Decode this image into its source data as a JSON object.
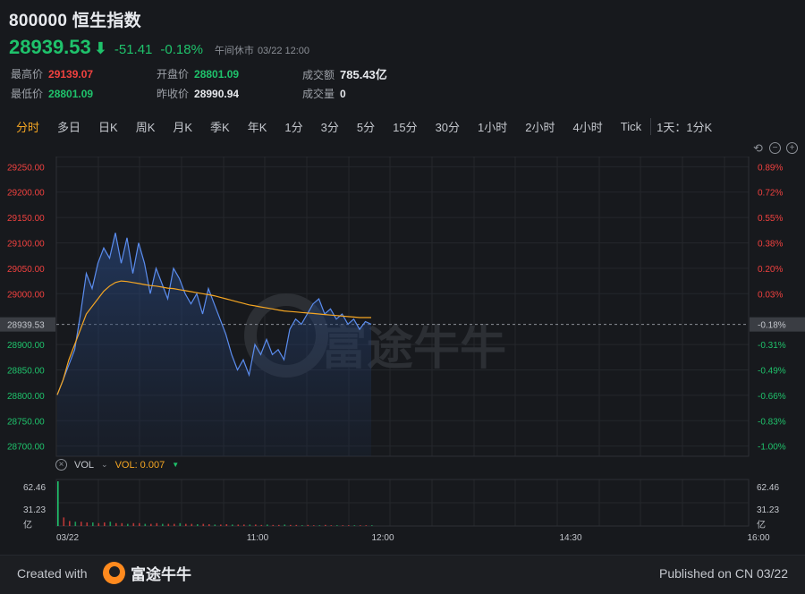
{
  "header": {
    "title": "800000 恒生指数",
    "price": "28939.53",
    "arrow": "⬇",
    "change": "-51.41",
    "change_pct": "-0.18%",
    "status": "午间休市",
    "datetime": "03/22 12:00"
  },
  "stats": {
    "high_label": "最高价",
    "high": "29139.07",
    "low_label": "最低价",
    "low": "28801.09",
    "open_label": "开盘价",
    "open": "28801.09",
    "prev_label": "昨收价",
    "prev": "28990.94",
    "turnover_label": "成交额",
    "turnover": "785.43亿",
    "volume_label": "成交量",
    "volume": "0"
  },
  "tabs": [
    "分时",
    "多日",
    "日K",
    "周K",
    "月K",
    "季K",
    "年K",
    "1分",
    "3分",
    "5分",
    "15分",
    "30分",
    "1小时",
    "2小时",
    "4小时",
    "Tick"
  ],
  "active_tab": "分时",
  "duration": "1天：1分K",
  "tools": {
    "reset": "⟲",
    "zoom_out": "−",
    "zoom_in": "+"
  },
  "volume_panel": {
    "name": "VOL",
    "dropdown": "⌄",
    "value": "VOL: 0.007",
    "trend": "▼",
    "axis_labels": [
      "62.46",
      "31.23",
      "亿"
    ]
  },
  "watermark": "富途牛牛",
  "footer": {
    "created": "Created with",
    "brand": "富途牛牛",
    "published": "Published on CN 03/22"
  },
  "colors": {
    "up": "#f0413f",
    "down": "#1fc26b",
    "accent": "#f5a623",
    "line": "#5b8def",
    "avg": "#f5a623"
  },
  "chart_data": {
    "type": "line",
    "y_left_ticks": [
      "29250.00",
      "29200.00",
      "29150.00",
      "29100.00",
      "29050.00",
      "29000.00",
      "28939.53",
      "28900.00",
      "28850.00",
      "28800.00",
      "28750.00",
      "28700.00"
    ],
    "y_right_ticks": [
      "0.89%",
      "0.72%",
      "0.55%",
      "0.38%",
      "0.20%",
      "0.03%",
      "-0.18%",
      "-0.31%",
      "-0.49%",
      "-0.66%",
      "-0.83%",
      "-1.00%"
    ],
    "x_ticks": [
      "03/22",
      "11:00",
      "12:00",
      "14:30",
      "16:00"
    ],
    "ylim": [
      28680,
      29270
    ],
    "last_price": 28939.53,
    "price": [
      28801,
      28830,
      28860,
      28890,
      28960,
      29040,
      29010,
      29060,
      29090,
      29070,
      29120,
      29060,
      29110,
      29040,
      29100,
      29060,
      29000,
      29050,
      29020,
      28990,
      29050,
      29030,
      29000,
      28980,
      29000,
      28960,
      29010,
      28980,
      28950,
      28920,
      28880,
      28850,
      28870,
      28840,
      28900,
      28880,
      28910,
      28880,
      28890,
      28870,
      28930,
      28950,
      28940,
      28960,
      28980,
      28990,
      28960,
      28970,
      28950,
      28960,
      28940,
      28950,
      28930,
      28945,
      28940
    ],
    "avg": [
      28801,
      28830,
      28870,
      28900,
      28930,
      28960,
      28975,
      28990,
      29005,
      29015,
      29022,
      29025,
      29024,
      29022,
      29020,
      29018,
      29016,
      29015,
      29013,
      29011,
      29010,
      29008,
      29006,
      29004,
      29002,
      29000,
      28998,
      28996,
      28993,
      28990,
      28987,
      28984,
      28981,
      28978,
      28976,
      28974,
      28972,
      28970,
      28968,
      28966,
      28965,
      28964,
      28963,
      28962,
      28961,
      28960,
      28959,
      28958,
      28957,
      28956,
      28955,
      28954,
      28953,
      28953,
      28953
    ],
    "volume_ylim": [
      0,
      62.46
    ],
    "volume": [
      62.46,
      12,
      7,
      6,
      6,
      5,
      5,
      4,
      5,
      6,
      4,
      4,
      3,
      4,
      4,
      3,
      3,
      4,
      3,
      3,
      3,
      4,
      3,
      3,
      2.5,
      3,
      2.5,
      2,
      2,
      2.5,
      2,
      2,
      2,
      2,
      2,
      1.5,
      2,
      1.5,
      1.5,
      2,
      1.5,
      1.5,
      1,
      1.5,
      1,
      1,
      1.5,
      1,
      1,
      1,
      1,
      1,
      1,
      1,
      1
    ]
  }
}
